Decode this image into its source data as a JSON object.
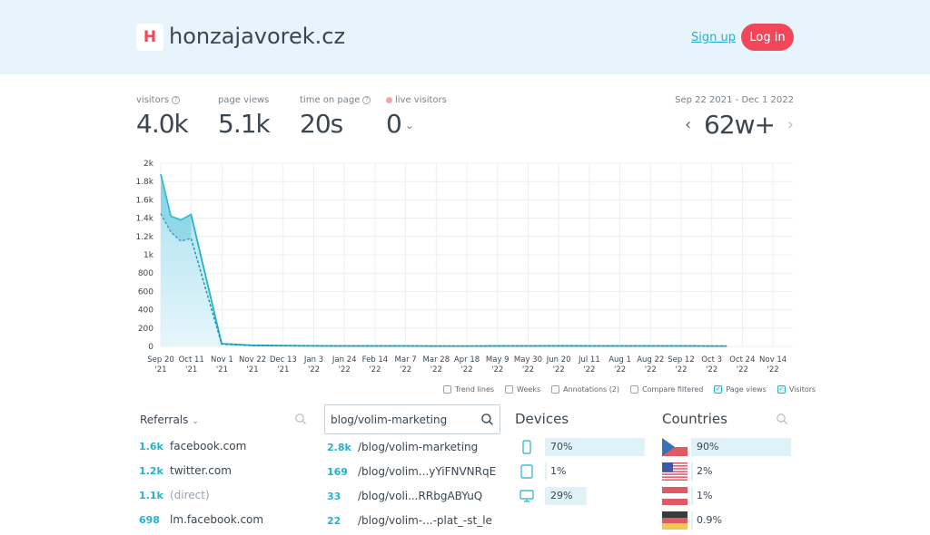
{
  "header": {
    "logo_letter": "H",
    "site_name": "honzajavorek.cz",
    "signup_label": "Sign up",
    "login_label": "Log in"
  },
  "stats": {
    "visitors": {
      "label": "visitors",
      "value": "4.0k"
    },
    "page_views": {
      "label": "page views",
      "value": "5.1k"
    },
    "time_on_page": {
      "label": "time on page",
      "value": "20s"
    },
    "live_visitors": {
      "label": "live visitors",
      "value": "0"
    }
  },
  "period": {
    "date_range": "Sep 22 2021 - Dec 1 2022",
    "value": "62w+"
  },
  "colors": {
    "accent": "#21b3cf",
    "brand": "#f2465a",
    "header_bg": "#e8f4fc"
  },
  "chart_data": {
    "type": "area",
    "y_ticks": [
      "2k",
      "1.8k",
      "1.6k",
      "1.4k",
      "1.2k",
      "1k",
      "800",
      "600",
      "400",
      "200",
      "0"
    ],
    "ylim": [
      0,
      2000
    ],
    "x_ticks": [
      {
        "top": "Sep 20",
        "bottom": "'21"
      },
      {
        "top": "Oct 11",
        "bottom": "'21"
      },
      {
        "top": "Nov 1",
        "bottom": "'21"
      },
      {
        "top": "Nov 22",
        "bottom": "'21"
      },
      {
        "top": "Dec 13",
        "bottom": "'21"
      },
      {
        "top": "Jan 3",
        "bottom": "'22"
      },
      {
        "top": "Jan 24",
        "bottom": "'22"
      },
      {
        "top": "Feb 14",
        "bottom": "'22"
      },
      {
        "top": "Mar 7",
        "bottom": "'22"
      },
      {
        "top": "Mar 28",
        "bottom": "'22"
      },
      {
        "top": "Apr 18",
        "bottom": "'22"
      },
      {
        "top": "May 9",
        "bottom": "'22"
      },
      {
        "top": "May 30",
        "bottom": "'22"
      },
      {
        "top": "Jun 20",
        "bottom": "'22"
      },
      {
        "top": "Jul 11",
        "bottom": "'22"
      },
      {
        "top": "Aug 1",
        "bottom": "'22"
      },
      {
        "top": "Aug 22",
        "bottom": "'22"
      },
      {
        "top": "Sep 12",
        "bottom": "'22"
      },
      {
        "top": "Oct 3",
        "bottom": "'22"
      },
      {
        "top": "Oct 24",
        "bottom": "'22"
      },
      {
        "top": "Nov 14",
        "bottom": "'22"
      }
    ],
    "series": [
      {
        "name": "Page views",
        "points": [
          [
            0,
            1880
          ],
          [
            1,
            1420
          ],
          [
            2,
            1380
          ],
          [
            3,
            1440
          ],
          [
            4,
            30
          ],
          [
            5,
            12
          ],
          [
            6,
            8
          ],
          [
            7,
            6
          ],
          [
            8,
            5
          ],
          [
            9,
            5
          ],
          [
            10,
            5
          ],
          [
            11,
            4
          ],
          [
            12,
            4
          ],
          [
            13,
            5
          ],
          [
            14,
            5
          ],
          [
            15,
            6
          ],
          [
            16,
            5
          ],
          [
            17,
            5
          ],
          [
            18,
            5
          ],
          [
            19,
            5
          ],
          [
            20,
            4
          ],
          [
            20.5,
            4
          ]
        ]
      },
      {
        "name": "Visitors",
        "points": [
          [
            0,
            1450
          ],
          [
            1,
            1250
          ],
          [
            2,
            1150
          ],
          [
            3,
            1180
          ],
          [
            4,
            25
          ],
          [
            5,
            10
          ],
          [
            6,
            7
          ],
          [
            7,
            5
          ],
          [
            8,
            4
          ],
          [
            9,
            4
          ],
          [
            10,
            4
          ],
          [
            11,
            3
          ],
          [
            12,
            3
          ],
          [
            13,
            4
          ],
          [
            14,
            4
          ],
          [
            15,
            5
          ],
          [
            16,
            4
          ],
          [
            17,
            4
          ],
          [
            18,
            4
          ],
          [
            19,
            4
          ],
          [
            20,
            3
          ],
          [
            20.5,
            3
          ]
        ]
      }
    ],
    "grid": true,
    "toggles": [
      {
        "label": "Trend lines",
        "checked": false
      },
      {
        "label": "Weeks",
        "checked": false
      },
      {
        "label": "Annotations (2)",
        "checked": false
      },
      {
        "label": "Compare filtered",
        "checked": false
      },
      {
        "label": "Page views",
        "checked": true
      },
      {
        "label": "Visitors",
        "checked": true
      }
    ]
  },
  "referrals": {
    "title": "Referrals",
    "items": [
      {
        "count": "1.6k",
        "label": "facebook.com"
      },
      {
        "count": "1.2k",
        "label": "twitter.com"
      },
      {
        "count": "1.1k",
        "label": "(direct)"
      },
      {
        "count": "698",
        "label": "lm.facebook.com"
      }
    ]
  },
  "pages": {
    "search_value": "blog/volim-marketing",
    "items": [
      {
        "count": "2.8k",
        "label": "/blog/volim-marketing"
      },
      {
        "count": "169",
        "label": "/blog/volim...yYiFNVNRqE"
      },
      {
        "count": "33",
        "label": "/blog/voli...RRbgABYuQ"
      },
      {
        "count": "22",
        "label": "/blog/volim-...-plat_-st_le"
      }
    ]
  },
  "devices": {
    "title": "Devices",
    "items": [
      {
        "icon": "phone-icon",
        "pct": "70%",
        "fraction": 0.7
      },
      {
        "icon": "tablet-icon",
        "pct": "1%",
        "fraction": 0.01
      },
      {
        "icon": "desktop-icon",
        "pct": "29%",
        "fraction": 0.29
      }
    ]
  },
  "countries": {
    "title": "Countries",
    "items": [
      {
        "flag": "czech-flag-icon",
        "pct": "90%",
        "fraction": 0.9
      },
      {
        "flag": "us-flag-icon",
        "pct": "2%",
        "fraction": 0.02
      },
      {
        "flag": "austria-flag-icon",
        "pct": "1%",
        "fraction": 0.01
      },
      {
        "flag": "germany-flag-icon",
        "pct": "0.9%",
        "fraction": 0.009
      }
    ]
  }
}
